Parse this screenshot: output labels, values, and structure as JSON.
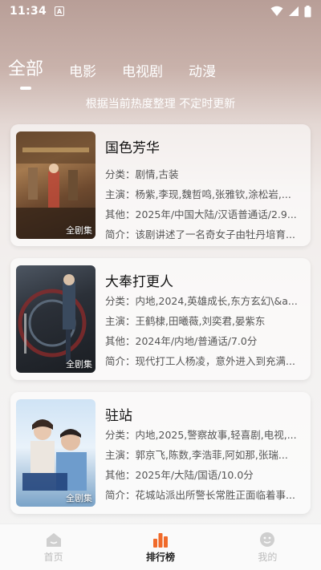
{
  "status": {
    "time": "11:34",
    "a_icon": "A"
  },
  "tabs": [
    {
      "label": "全部",
      "active": true
    },
    {
      "label": "电影",
      "active": false
    },
    {
      "label": "电视剧",
      "active": false
    },
    {
      "label": "动漫",
      "active": false
    }
  ],
  "subtitle": "根据当前热度整理 不定时更新",
  "cards": [
    {
      "title": "国色芳华",
      "badge": "全剧集",
      "rows": [
        {
          "k": "分类：",
          "v": "剧情,古装"
        },
        {
          "k": "主演：",
          "v": "杨紫,李现,魏哲鸣,张雅钦,涂松岩,..."
        },
        {
          "k": "其他：",
          "v": "2025年/中国大陆/汉语普通话/2.9..."
        },
        {
          "k": "简介：",
          "v": "该剧讲述了一名奇女子由牡丹培育..."
        }
      ]
    },
    {
      "title": "大奉打更人",
      "badge": "全剧集",
      "rows": [
        {
          "k": "分类：",
          "v": "内地,2024,英雄成长,东方玄幻\\&a..."
        },
        {
          "k": "主演：",
          "v": "王鹤棣,田曦薇,刘奕君,晏紫东"
        },
        {
          "k": "其他：",
          "v": "2024年/内地/普通话/7.0分"
        },
        {
          "k": "简介：",
          "v": "现代打工人杨凌，意外进入到充满..."
        }
      ]
    },
    {
      "title": "驻站",
      "badge": "全剧集",
      "rows": [
        {
          "k": "分类：",
          "v": "内地,2025,警察故事,轻喜剧,电视,..."
        },
        {
          "k": "主演：",
          "v": "郭京飞,陈数,李浩菲,阿如那,张瑞..."
        },
        {
          "k": "其他：",
          "v": "2025年/大陆/国语/10.0分"
        },
        {
          "k": "简介：",
          "v": "花城站派出所警长常胜正面临着事..."
        }
      ]
    }
  ],
  "nav": [
    {
      "label": "首页",
      "icon": "home-icon",
      "active": false
    },
    {
      "label": "排行榜",
      "icon": "ranking-icon",
      "active": true
    },
    {
      "label": "我的",
      "icon": "profile-icon",
      "active": false
    }
  ],
  "colors": {
    "accent": "#f06a2a",
    "inactive": "#bbbbbb"
  }
}
